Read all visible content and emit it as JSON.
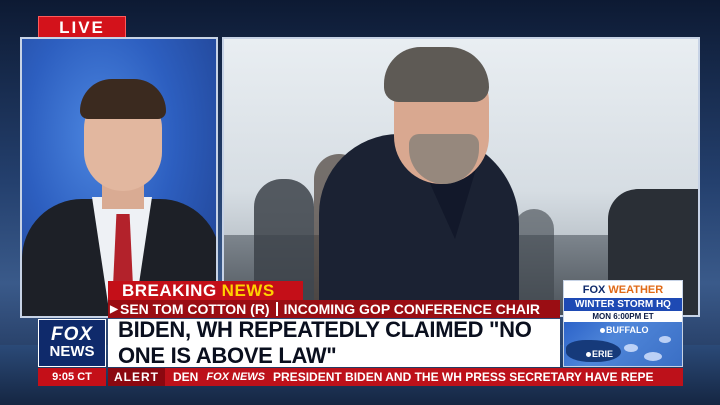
{
  "live_badge": "LIVE",
  "breaking": {
    "word1": "BREAKING",
    "word2": "NEWS"
  },
  "nameline": {
    "name": "SEN TOM COTTON (R)",
    "title": "INCOMING GOP CONFERENCE CHAIR"
  },
  "headline": "BIDEN, WH REPEATEDLY CLAIMED \"NO ONE IS ABOVE LAW\"",
  "logo": {
    "fox": "FOX",
    "news": "NEWS"
  },
  "clock": "9:05 CT",
  "ticker": {
    "alert": "ALERT",
    "prev": "DEN",
    "brand": "FOX NEWS",
    "text": "PRESIDENT BIDEN AND THE WH PRESS SECRETARY HAVE REPE"
  },
  "weather": {
    "brand": "FOX",
    "brand2": "WEATHER",
    "storm": "WINTER STORM HQ",
    "time": "MON 6:00PM ET",
    "city1": "BUFFALO",
    "city2": "ERIE"
  },
  "colors": {
    "fox_red": "#c40f18",
    "fox_blue": "#0f2a6b",
    "breaking_yellow": "#ffd200"
  }
}
